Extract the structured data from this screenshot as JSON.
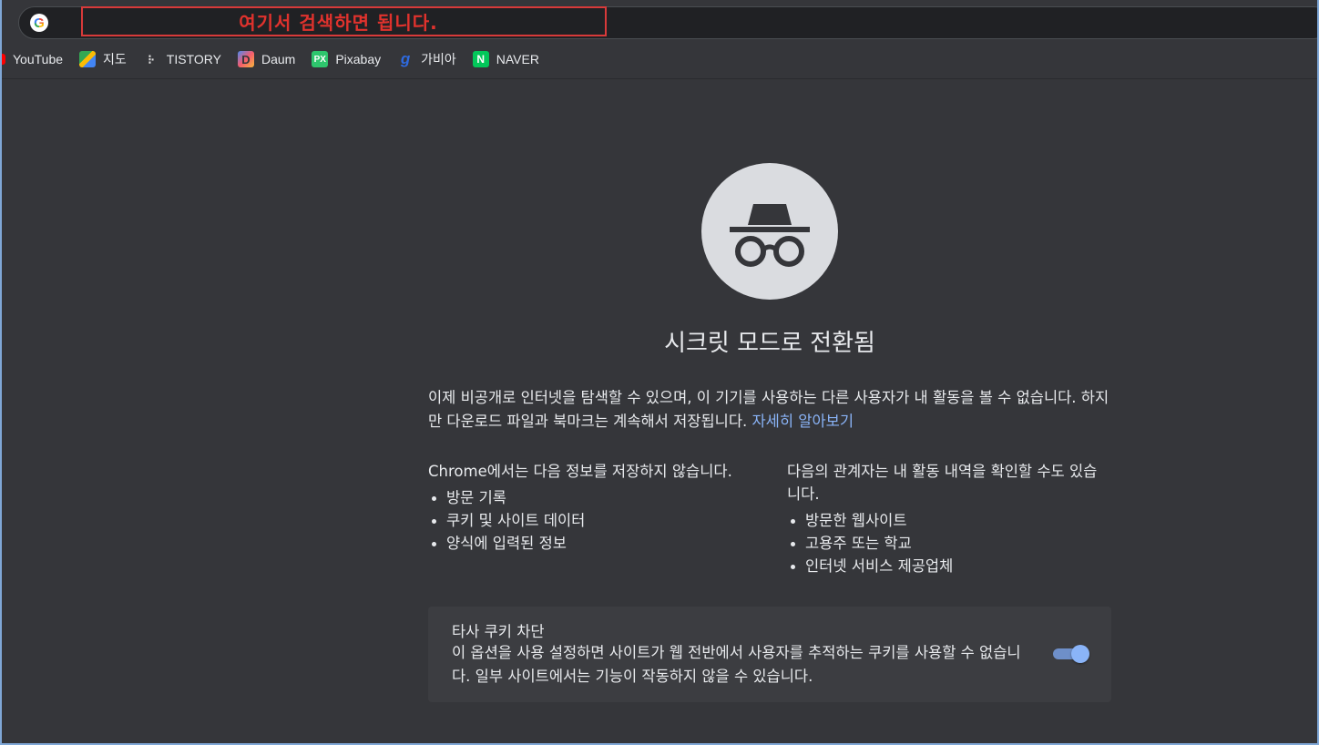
{
  "omnibox": {
    "annotation": "여기서 검색하면 됩니다."
  },
  "bookmarks": [
    {
      "label": "YouTube",
      "icon": "youtube-icon"
    },
    {
      "label": "지도",
      "icon": "maps-icon"
    },
    {
      "label": "TISTORY",
      "icon": "tistory-icon"
    },
    {
      "label": "Daum",
      "icon": "daum-icon"
    },
    {
      "label": "Pixabay",
      "icon": "pixabay-icon"
    },
    {
      "label": "가비아",
      "icon": "gabia-icon"
    },
    {
      "label": "NAVER",
      "icon": "naver-icon"
    }
  ],
  "main": {
    "icon": "incognito-icon",
    "title": "시크릿 모드로 전환됨",
    "intro": "이제 비공개로 인터넷을 탐색할 수 있으며, 이 기기를 사용하는 다른 사용자가 내 활동을 볼 수 없습니다. 하지만 다운로드 파일과 북마크는 계속해서 저장됩니다.",
    "learn_more": "자세히 알아보기",
    "not_saved": {
      "heading": "Chrome에서는 다음 정보를 저장하지 않습니다.",
      "items": [
        "방문 기록",
        "쿠키 및 사이트 데이터",
        "양식에 입력된 정보"
      ]
    },
    "visible_to": {
      "heading": "다음의 관계자는 내 활동 내역을 확인할 수도 있습니다.",
      "items": [
        "방문한 웹사이트",
        "고용주 또는 학교",
        "인터넷 서비스 제공업체"
      ]
    },
    "cookie_card": {
      "title": "타사 쿠키 차단",
      "description": "이 옵션을 사용 설정하면 사이트가 웹 전반에서 사용자를 추적하는 쿠키를 사용할 수 없습니다. 일부 사이트에서는 기능이 작동하지 않을 수 있습니다.",
      "toggle_on": true
    }
  },
  "colors": {
    "background": "#35363a",
    "link": "#8ab4f8",
    "annotation": "#e0322d",
    "toggle": "#8ab4f8"
  }
}
